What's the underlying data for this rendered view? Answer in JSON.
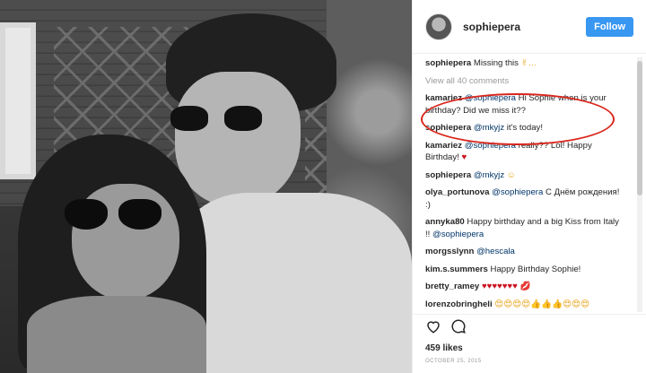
{
  "post": {
    "username": "sophiepera",
    "follow_label": "Follow",
    "caption_user": "sophiepera",
    "caption_text": "Missing this",
    "caption_emoji": "✌…",
    "view_all": "View all 40 comments",
    "comments": [
      {
        "user": "kamariez",
        "mention": "@sophiepera",
        "text": " Hi Sophie when is your birthday? Did we miss it??"
      },
      {
        "user": "sophiepera",
        "mention": "@mkyjz",
        "text": " it's today!"
      },
      {
        "user": "kamariez",
        "mention": "@sophiepera",
        "text": " really?? Lol! Happy Birthday!",
        "suffix": "♥"
      },
      {
        "user": "sophiepera",
        "mention": "@mkyjz",
        "text": "",
        "suffix": "☺"
      },
      {
        "user": "olya_portunova",
        "mention": "@sophiepera",
        "text": " С Днём рождения! :)"
      },
      {
        "user": "annyka80",
        "mention": "",
        "text": "Happy birthday and a big Kiss from Italy !! ",
        "mention2": "@sophiepera"
      },
      {
        "user": "morgsslynn",
        "mention": "@hescala",
        "text": ""
      },
      {
        "user": "kim.s.summers",
        "mention": "",
        "text": "Happy Birthday Sophie!"
      },
      {
        "user": "bretty_ramey",
        "mention": "",
        "text": "",
        "suffix": "♥♥♥♥♥♥♥ 💋"
      },
      {
        "user": "lorenzobringheli",
        "mention": "",
        "text": "",
        "suffix": "😍😍😍😍👍👍👍😍😍😍"
      }
    ],
    "likes": "459 likes",
    "date": "OCTOBER 25, 2015"
  },
  "icons": [
    "heart-icon",
    "comment-icon"
  ],
  "colors": {
    "follow": "#3897f0",
    "highlight": "#d9261c",
    "mention": "#003569"
  }
}
